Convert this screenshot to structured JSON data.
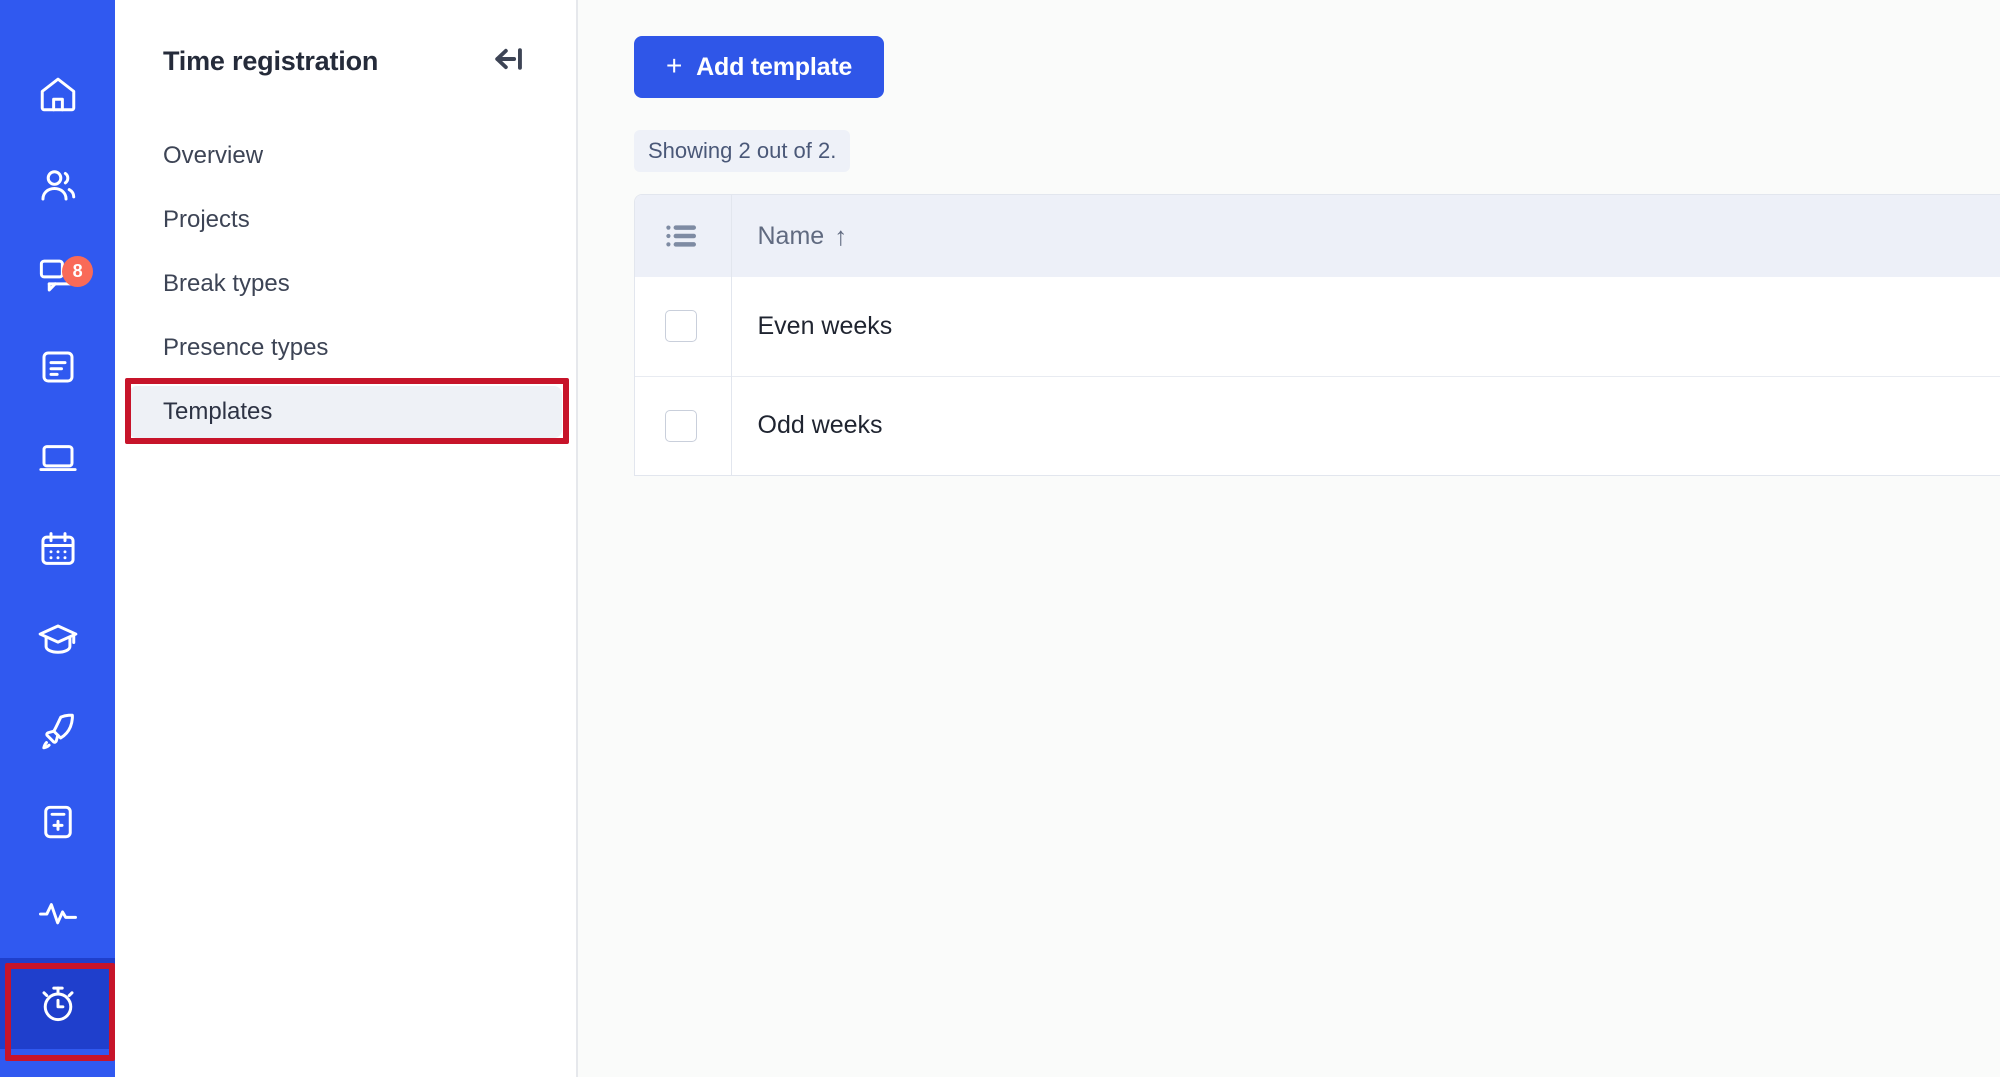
{
  "icon_rail": {
    "background_color": "#3059f0",
    "active_color": "#1f3fcc",
    "highlight_color": "#c7142a",
    "items": [
      {
        "icon": "home-icon",
        "badge": null
      },
      {
        "icon": "people-icon",
        "badge": null
      },
      {
        "icon": "chat-messages-icon",
        "badge": "8"
      },
      {
        "icon": "document-icon",
        "badge": null
      },
      {
        "icon": "laptop-icon",
        "badge": null
      },
      {
        "icon": "calendar-icon",
        "badge": null
      },
      {
        "icon": "graduation-cap-icon",
        "badge": null
      },
      {
        "icon": "rocket-icon",
        "badge": null
      },
      {
        "icon": "add-device-icon",
        "badge": null
      },
      {
        "icon": "activity-pulse-icon",
        "badge": null
      },
      {
        "icon": "stopwatch-icon",
        "badge": null
      }
    ],
    "active_index": 10,
    "badge_color": "#f96a58"
  },
  "nav_panel": {
    "title": "Time registration",
    "collapse_icon": "collapse-left-icon",
    "items": [
      {
        "label": "Overview",
        "active": false
      },
      {
        "label": "Projects",
        "active": false
      },
      {
        "label": "Break types",
        "active": false
      },
      {
        "label": "Presence types",
        "active": false
      },
      {
        "label": "Templates",
        "active": true
      }
    ],
    "highlighted_item": "Templates"
  },
  "main": {
    "add_button": {
      "plus": "+",
      "label": "Add template"
    },
    "showing_text": "Showing 2 out of 2.",
    "table": {
      "select_header_icon": "rows-list-icon",
      "columns": [
        {
          "key": "name",
          "label": "Name",
          "sort": "↑"
        }
      ],
      "rows": [
        {
          "name": "Even weeks",
          "selected": false
        },
        {
          "name": "Odd weeks",
          "selected": false
        }
      ]
    }
  },
  "colors": {
    "brand_blue": "#2f56e8",
    "rail_blue": "#3059f0",
    "highlight_red": "#c7142a",
    "badge_orange": "#f96a58",
    "header_row": "#edf0f8",
    "page_bg": "#fafbfa"
  }
}
